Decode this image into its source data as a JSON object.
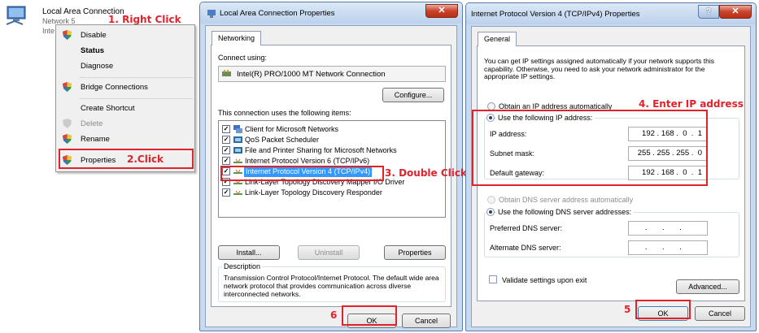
{
  "annotations": {
    "step1": "1. Right Click",
    "step2": "2.Click",
    "step3": "3. Double Click",
    "step4": "4. Enter IP address",
    "step5": "5",
    "step6": "6"
  },
  "network_item": {
    "name": "Local Area Connection",
    "sub1": "Network 5",
    "sub2": "Inte"
  },
  "context_menu": {
    "items": [
      "Disable",
      "Status",
      "Diagnose",
      "Bridge Connections",
      "Create Shortcut",
      "Delete",
      "Rename",
      "Properties"
    ]
  },
  "lac_dialog": {
    "title": "Local Area Connection Properties",
    "tab": "Networking",
    "connect_using_label": "Connect using:",
    "adapter": "Intel(R) PRO/1000 MT Network Connection",
    "configure_btn": "Configure...",
    "items_label": "This connection uses the following items:",
    "items": [
      "Client for Microsoft Networks",
      "QoS Packet Scheduler",
      "File and Printer Sharing for Microsoft Networks",
      "Internet Protocol Version 6 (TCP/IPv6)",
      "Internet Protocol Version 4 (TCP/IPv4)",
      "Link-Layer Topology Discovery Mapper I/O Driver",
      "Link-Layer Topology Discovery Responder"
    ],
    "install_btn": "Install...",
    "uninstall_btn": "Uninstall",
    "properties_btn": "Properties",
    "description_title": "Description",
    "description": "Transmission Control Protocol/Internet Protocol. The default wide area network protocol that provides communication across diverse interconnected networks.",
    "ok_btn": "OK",
    "cancel_btn": "Cancel"
  },
  "ipv4_dialog": {
    "title": "Internet Protocol Version 4 (TCP/IPv4) Properties",
    "tab": "General",
    "intro": "You can get IP settings assigned automatically if your network supports this capability. Otherwise, you need to ask your network administrator for the appropriate IP settings.",
    "auto_ip": "Obtain an IP address automatically",
    "manual_ip": "Use the following IP address:",
    "ip_label": "IP address:",
    "ip_value": "192 . 168 .  0  .  1",
    "mask_label": "Subnet mask:",
    "mask_value": "255 . 255 . 255 .  0",
    "gw_label": "Default gateway:",
    "gw_value": "192 . 168 .  0  .  1",
    "auto_dns": "Obtain DNS server address automatically",
    "manual_dns": "Use the following DNS server addresses:",
    "pref_dns_label": "Preferred DNS server:",
    "pref_dns_value": " .       .       .   ",
    "alt_dns_label": "Alternate DNS server:",
    "alt_dns_value": " .       .       .   ",
    "validate": "Validate settings upon exit",
    "advanced_btn": "Advanced...",
    "ok_btn": "OK",
    "cancel_btn": "Cancel"
  }
}
